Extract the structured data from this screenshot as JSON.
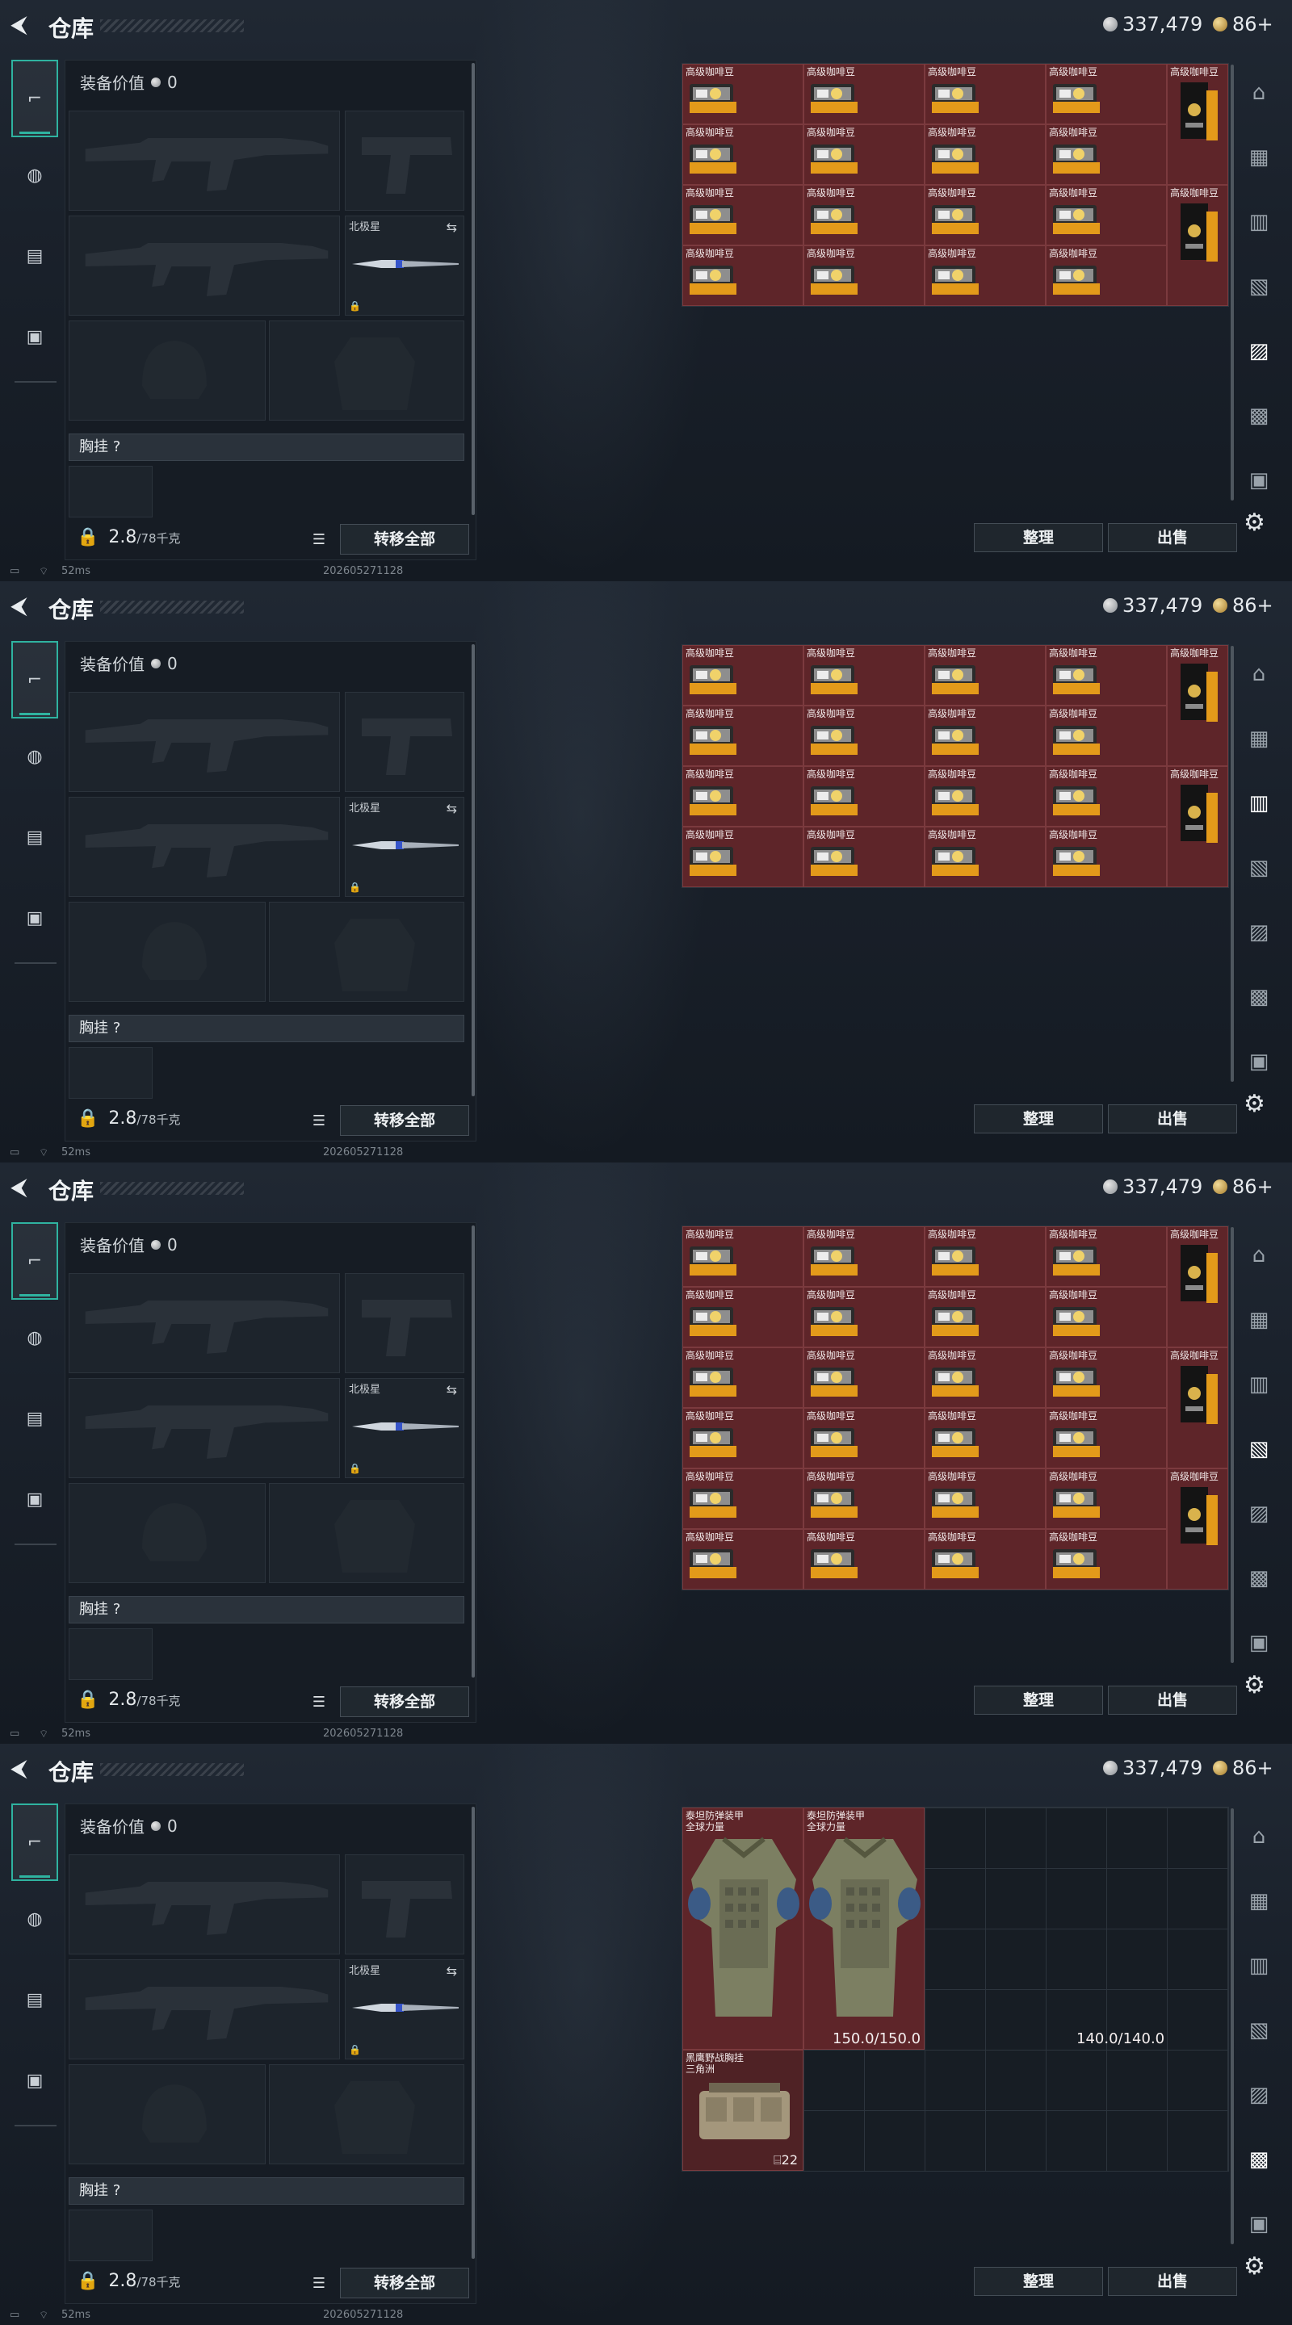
{
  "screens": [
    {
      "tab": "cuisine",
      "stash": "coffee"
    },
    {
      "tab": "tools",
      "stash": "coffee"
    },
    {
      "tab": "ammo",
      "stash": "coffee6"
    },
    {
      "tab": "armor",
      "stash": "armor"
    }
  ],
  "header": {
    "back_label": "⮜",
    "title": "仓库",
    "currency_silver": "337,479",
    "currency_gold": "86+"
  },
  "loadout": {
    "equip_value_label": "装备价值",
    "equip_value": "0",
    "melee_name": "北极星",
    "rig_label": "胸挂",
    "rig_help": "?",
    "weight_current": "2.8",
    "weight_max": "/78千克",
    "move_all_label": "转移全部"
  },
  "stash": {
    "coffee_label": "高级咖啡豆",
    "sort_label": "整理",
    "sell_label": "出售",
    "armor_items": [
      {
        "name": "泰坦防弹装甲\n全球力量",
        "durability": "150.0/150.0"
      },
      {
        "name": "泰坦防弹装甲\n全球力量",
        "durability": "140.0/140.0"
      }
    ],
    "rig_item": {
      "name": "黑鹰野战胸挂\n三角洲",
      "count": "22"
    }
  },
  "statusbar": {
    "ping": "52ms",
    "build": "202605271128"
  },
  "colors": {
    "accent": "#2fb3a0",
    "item_red": "#5e2529",
    "panel": "#161c24"
  },
  "icons": [
    "back-arrow-icon",
    "silver-coin-icon",
    "gold-coin-icon",
    "pistol-icon",
    "helmet-icon",
    "backpack-icon",
    "briefcase-icon",
    "lock-icon",
    "swap-icon",
    "list-icon",
    "gear-icon",
    "wifi-icon",
    "battery-icon"
  ]
}
